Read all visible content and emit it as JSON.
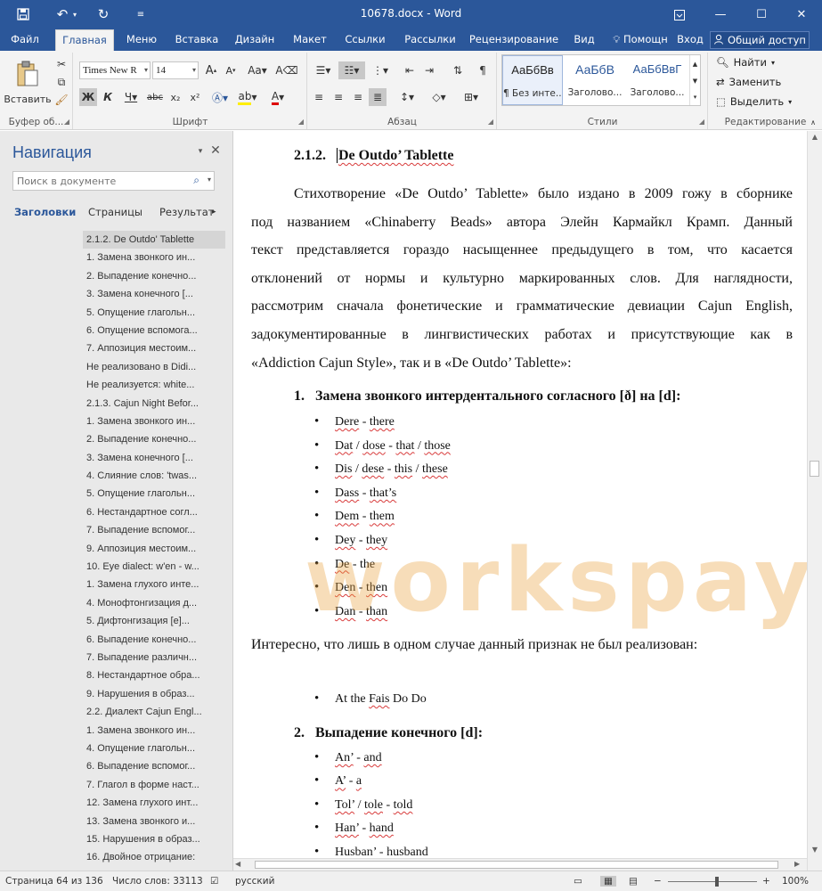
{
  "window": {
    "title": "10678.docx - Word"
  },
  "menu": {
    "tabs": [
      "Файл",
      "Главная",
      "Меню",
      "Вставка",
      "Дизайн",
      "Макет",
      "Ссылки",
      "Рассылки",
      "Рецензирование",
      "Вид"
    ],
    "help": "Помощн",
    "login": "Вход",
    "share": "Общий доступ"
  },
  "ribbon": {
    "paste_label": "Вставить",
    "clipboard_group": "Буфер об...",
    "font_group": "Шрифт",
    "paragraph_group": "Абзац",
    "styles_group": "Стили",
    "editing_group": "Редактирование",
    "font_name": "Times New R",
    "font_size": "14",
    "styles": [
      {
        "preview": "АаБбВв",
        "name": "¶ Без инте..."
      },
      {
        "preview": "АаБбВ",
        "name": "Заголово..."
      },
      {
        "preview": "АаБбВвГ",
        "name": "Заголово..."
      }
    ],
    "find": "Найти",
    "replace": "Заменить",
    "select": "Выделить"
  },
  "nav": {
    "title": "Навигация",
    "search_placeholder": "Поиск в документе",
    "tabs": [
      "Заголовки",
      "Страницы",
      "Результать"
    ],
    "items": [
      "2.1.2. De Outdo' Tablette",
      "1. Замена звонкого ин...",
      "2. Выпадение конечно...",
      "3. Замена конечного [...",
      "5. Опущение глагольн...",
      "6. Опущение вспомога...",
      "7. Аппозиция местоим...",
      "Не реализовано в Didi...",
      "Не реализуется: white...",
      "2.1.3. Cajun Night Befor...",
      "1. Замена звонкого ин...",
      "2. Выпадение конечно...",
      "3. Замена конечного [...",
      "4. Слияние слов: 'twas...",
      "5. Опущение глагольн...",
      "6. Нестандартное согл...",
      "7. Выпадение вспомог...",
      "9. Аппозиция местоим...",
      "10. Eye dialect: w'en - w...",
      "1. Замена глухого инте...",
      "4. Монофтонгизация д...",
      "5. Дифтонгизация [e]...",
      "6. Выпадение конечно...",
      "7. Выпадение различн...",
      "8. Нестандартное обра...",
      "9. Нарушения в образ...",
      "2.2. Диалект Cajun Engl...",
      "1. Замена звонкого ин...",
      "4. Опущение глагольн...",
      "6. Выпадение вспомог...",
      "7. Глагол в форме наст...",
      "12. Замена глухого инт...",
      "13. Замена звонкого и...",
      "15. Нарушения в образ...",
      "16. Двойное отрицание:"
    ]
  },
  "document": {
    "heading_num": "2.1.2.",
    "heading_text": "De Outdo’ Tablette",
    "body_lines": [
      "Стихотворение «De Outdo’ Tablette» было издано в 2009 гожу в сборнике",
      "под названием «Chinaberry Beads» автора Элейн Кармайкл Крамп. Данный",
      "текст представляется гораздо насыщеннее предыдущего в том, что касается",
      "отклонений от нормы и культурно маркированных слов. Для наглядности,",
      "рассмотрим сначала фонетические и грамматические девиации Cajun English,",
      "задокументированные в лингвистических работах и присутствующие как в",
      "«Addiction Cajun Style», так и в «De Outdo’ Tablette»:"
    ],
    "list1_num": "1.",
    "list1_head": "Замена звонкого интердентального согласного [ð] на [d]:",
    "list1_items": [
      "Dere   - there",
      "Dat /    dose - that / those",
      "Dis /     dese - this / these",
      "Dass    - that’s",
      "Dem     - them",
      "Dey - they",
      "De - the",
      "Den - then",
      "Dan - than"
    ],
    "para2": "Интересно, что лишь в одном случае данный признак не был реализован:",
    "list_extra": [
      "At the Fais Do Do"
    ],
    "list2_num": "2.",
    "list2_head": "Выпадение конечного [d]:",
    "list2_items": [
      "An’ - and",
      "A’ - a",
      "Tol’ / tole - told",
      "Han’ - hand",
      "Husban’ - husband"
    ],
    "watermark": "workspay.ru"
  },
  "status": {
    "page": "Страница 64 из 136",
    "words": "Число слов: 33113",
    "lang": "русский",
    "zoom": "100%"
  },
  "colors": {
    "accent": "#2b579a",
    "watermark": "#e8a03c"
  }
}
